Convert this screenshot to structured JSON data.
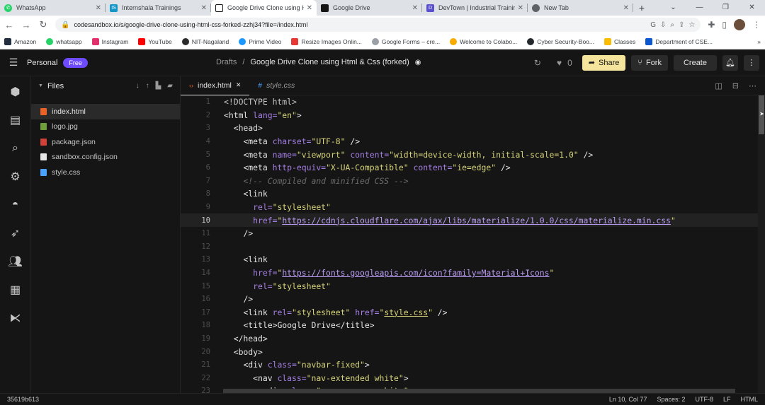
{
  "browser": {
    "tabs": [
      {
        "title": "WhatsApp",
        "color": "#25d366",
        "icon": "whatsapp-icon"
      },
      {
        "title": "Internshala Trainings",
        "color": "#1295c9",
        "icon": "internshala-icon"
      },
      {
        "title": "Google Drive Clone using H",
        "color": "#151515",
        "icon": "codesandbox-icon"
      },
      {
        "title": "Google Drive",
        "color": "#151515",
        "icon": "codesandbox-icon"
      },
      {
        "title": "DevTown | Industrial Trainin",
        "color": "#5a4fcf",
        "icon": "devtown-icon"
      },
      {
        "title": "New Tab",
        "color": "#5f6368",
        "icon": "globe-icon"
      }
    ],
    "active_tab": 2,
    "url": "codesandbox.io/s/google-drive-clone-using-html-css-forked-zzhj34?file=/index.html",
    "bookmarks": [
      {
        "label": "Amazon",
        "color": "#232f3e"
      },
      {
        "label": "whatsapp",
        "color": "#25d366"
      },
      {
        "label": "Instagram",
        "color": "#e1306c"
      },
      {
        "label": "YouTube",
        "color": "#ff0000"
      },
      {
        "label": "NIT-Nagaland",
        "color": "#2b2b2b"
      },
      {
        "label": "Prime Video",
        "color": "#1a98ff"
      },
      {
        "label": "Resize Images Onlin...",
        "color": "#e53935"
      },
      {
        "label": "Google Forms – cre...",
        "color": "#9aa0a6"
      },
      {
        "label": "Welcome to Colabo...",
        "color": "#f9ab00"
      },
      {
        "label": "Cyber Security-Boo...",
        "color": "#24292e"
      },
      {
        "label": "Classes",
        "color": "#fbbc04"
      },
      {
        "label": "Department of CSE...",
        "color": "#0b57d0"
      }
    ]
  },
  "sandbox": {
    "workspace": "Personal",
    "plan_badge": "Free",
    "breadcrumb_parent": "Drafts",
    "breadcrumb_separator": "/",
    "title": "Google Drive Clone using Html & Css (forked)",
    "likes": "0",
    "share_label": "Share",
    "fork_label": "Fork",
    "create_label": "Create",
    "files_heading": "Files",
    "files": [
      {
        "name": "index.html",
        "color": "#e96228"
      },
      {
        "name": "logo.jpg",
        "color": "#6f9e3d"
      },
      {
        "name": "package.json",
        "color": "#d0413a"
      },
      {
        "name": "sandbox.config.json",
        "color": "#e5e5e5"
      },
      {
        "name": "style.css",
        "color": "#4aa3ff"
      }
    ],
    "selected_file": 0,
    "editor_tabs": [
      {
        "name": "index.html",
        "close": "✕"
      },
      {
        "name": "style.css"
      }
    ],
    "status": {
      "commit": "35619b613",
      "position": "Ln 10, Col 77",
      "spaces": "Spaces: 2",
      "encoding": "UTF-8",
      "eol": "LF",
      "language": "HTML"
    }
  },
  "code_lines": [
    {
      "n": "1"
    },
    {
      "n": "2"
    },
    {
      "n": "3"
    },
    {
      "n": "4"
    },
    {
      "n": "5"
    },
    {
      "n": "6"
    },
    {
      "n": "7"
    },
    {
      "n": "8"
    },
    {
      "n": "9"
    },
    {
      "n": "10"
    },
    {
      "n": "11"
    },
    {
      "n": "12"
    },
    {
      "n": "13"
    },
    {
      "n": "14"
    },
    {
      "n": "15"
    },
    {
      "n": "16"
    },
    {
      "n": "17"
    },
    {
      "n": "18"
    },
    {
      "n": "19"
    },
    {
      "n": "20"
    },
    {
      "n": "21"
    },
    {
      "n": "22"
    },
    {
      "n": "23"
    }
  ],
  "code_text": {
    "l1": "<!DOCTYPE html>",
    "l2_a": "<html ",
    "l2_b": "lang=",
    "l2_c": "\"en\"",
    "l2_d": ">",
    "l3": "<head>",
    "l4_a": "<meta ",
    "l4_b": "charset=",
    "l4_c": "\"UTF-8\"",
    "l4_d": " />",
    "l5_a": "<meta ",
    "l5_b": "name=",
    "l5_c": "\"viewport\"",
    "l5_d": " ",
    "l5_e": "content=",
    "l5_f": "\"width=device-width, initial-scale=1.0\"",
    "l5_g": " />",
    "l6_a": "<meta ",
    "l6_b": "http-equiv=",
    "l6_c": "\"X-UA-Compatible\"",
    "l6_d": " ",
    "l6_e": "content=",
    "l6_f": "\"ie=edge\"",
    "l6_g": " />",
    "l7": "<!-- Compiled and minified CSS -->",
    "l8": "<link",
    "l9_a": "rel=",
    "l9_b": "\"stylesheet\"",
    "l10_a": "href=",
    "l10_b": "\"",
    "l10_c": "https://cdnjs.cloudflare.com/ajax/libs/materialize/1.0.0/css/materialize.min.css",
    "l10_d": "\"",
    "l11": "/>",
    "l13": "<link",
    "l14_a": "href=",
    "l14_b": "\"",
    "l14_c": "https://fonts.googleapis.com/icon?family=Material+Icons",
    "l14_d": "\"",
    "l15_a": "rel=",
    "l15_b": "\"stylesheet\"",
    "l16": "/>",
    "l17_a": "<link ",
    "l17_b": "rel=",
    "l17_c": "\"stylesheet\"",
    "l17_d": " ",
    "l17_e": "href=",
    "l17_f": "\"",
    "l17_g": "style.css",
    "l17_h": "\"",
    "l17_i": " />",
    "l18_a": "<title>",
    "l18_b": "Google Drive",
    "l18_c": "</title>",
    "l19": "</head>",
    "l20": "<body>",
    "l21_a": "<div ",
    "l21_b": "class=",
    "l21_c": "\"navbar-fixed\"",
    "l21_d": ">",
    "l22_a": "<nav ",
    "l22_b": "class=",
    "l22_c": "\"nav-extended white\"",
    "l22_d": ">",
    "l23_a": "<div ",
    "l23_b": "class=",
    "l23_c": "\"nav-wrapper white\"",
    "l23_d": ">"
  }
}
